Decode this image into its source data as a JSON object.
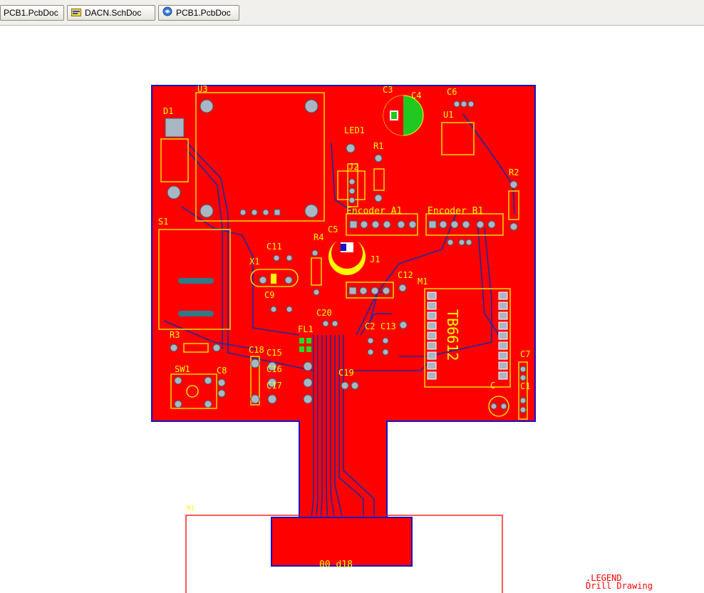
{
  "tabs": [
    {
      "label": "PCB1.PcbDoc",
      "icon": "pcb-doc-icon"
    },
    {
      "label": "DACN.SchDoc",
      "icon": "schematic-doc-icon"
    },
    {
      "label": "PCB1.PcbDoc",
      "icon": "pcb-3d-doc-icon"
    }
  ],
  "colors": {
    "board": "#ff0000",
    "board_outline": "#1414c8",
    "silkscreen": "#ffff00",
    "pad": "#a9b6c4",
    "component_green": "#22cc22",
    "bottom_track": "#1a2aa0"
  },
  "board": {
    "designators": {
      "u3": "U3",
      "d1": "D1",
      "c3": "C3",
      "c4": "C4",
      "c6": "C6",
      "u1": "U1",
      "led1": "LED1",
      "r1": "R1",
      "j2": "J2",
      "r2": "R2",
      "s1": "S1",
      "enc_a": "Encoder A1",
      "enc_b": "Encoder B1",
      "c5": "C5",
      "r4": "R4",
      "c11": "C11",
      "x1": "X1",
      "j1": "J1",
      "c9": "C9",
      "c12": "C12",
      "m1": "M1",
      "c20": "C20",
      "fl1": "FL1",
      "c2": "C2",
      "c13": "C13",
      "r3": "R3",
      "c18": "C18",
      "c15": "C15",
      "c16": "C16",
      "c17": "C17",
      "c19": "C19",
      "sw1": "SW1",
      "c8": "C8",
      "c7": "C7",
      "c1": "C1",
      "c_small": "C",
      "tb6612": "TB6612",
      "m1_connector": "M1",
      "bottom_text": "00 d18"
    }
  },
  "legend": {
    "line1": ".LEGEND",
    "line2": "Drill Drawing"
  }
}
